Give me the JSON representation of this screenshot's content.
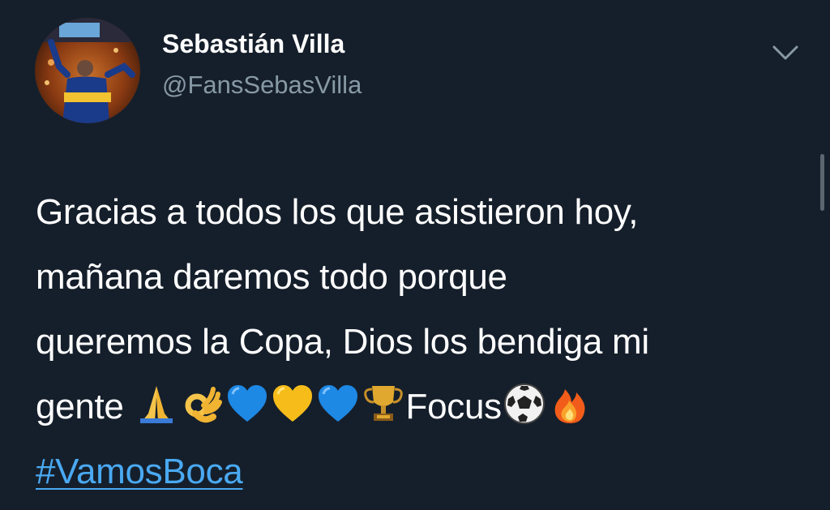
{
  "tweet": {
    "author": {
      "display_name": "Sebastián Villa",
      "handle": "@FansSebasVilla"
    },
    "text_lines": [
      "Gracias a todos los que asistieron hoy,",
      "mañana daremos todo porque",
      "queremos la Copa, Dios los bendiga mi"
    ],
    "line4_start": "gente ",
    "line4_focus": "Focus",
    "hashtag": "#VamosBoca",
    "emojis": [
      "folded-hands-emoji",
      "ok-hand-emoji",
      "blue-heart-emoji",
      "yellow-heart-emoji",
      "blue-heart-emoji",
      "trophy-emoji",
      "soccer-ball-emoji",
      "fire-emoji"
    ]
  },
  "colors": {
    "background": "#151f2b",
    "text": "#ffffff",
    "handle": "#8899a6",
    "hashtag": "#4aa9f2"
  },
  "icons": {
    "menu": "chevron-down-icon"
  }
}
